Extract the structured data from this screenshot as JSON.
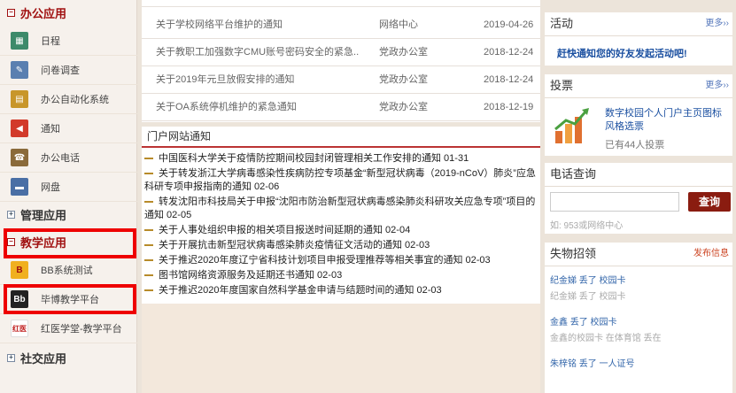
{
  "sidebar": {
    "office_title": "办公应用",
    "office_items": [
      {
        "label": "日程",
        "icon": "calendar-icon"
      },
      {
        "label": "问卷调查",
        "icon": "survey-icon"
      },
      {
        "label": "办公自动化系统",
        "icon": "office-system-icon"
      },
      {
        "label": "通知",
        "icon": "notice-icon"
      },
      {
        "label": "办公电话",
        "icon": "phone-icon"
      },
      {
        "label": "网盘",
        "icon": "netdisk-icon"
      }
    ],
    "manage_title": "管理应用",
    "teach_title": "教学应用",
    "teach_items": [
      {
        "label": "BB系统测试",
        "icon": "bb-icon"
      },
      {
        "label": "毕博教学平台",
        "icon": "bb-platform-icon"
      },
      {
        "label": "红医学堂-教学平台",
        "icon": "hongyi-icon"
      }
    ],
    "social_title": "社交应用"
  },
  "notices": [
    {
      "title": "关于学校网络平台维护的通知",
      "dept": "网络中心",
      "date": "2019-04-26"
    },
    {
      "title": "关于教职工加强数字CMU账号密码安全的紧急...",
      "dept": "党政办公室",
      "date": "2018-12-24"
    },
    {
      "title": "关于2019年元旦放假安排的通知",
      "dept": "党政办公室",
      "date": "2018-12-24"
    },
    {
      "title": "关于OA系统停机维护的紧急通知",
      "dept": "党政办公室",
      "date": "2018-12-19"
    }
  ],
  "portal": {
    "title": "门户网站通知",
    "items": [
      "中国医科大学关于疫情防控期间校园封闭管理相关工作安排的通知 01-31",
      "关于转发浙江大学病毒感染性疾病防控专项基金“新型冠状病毒（2019-nCoV）肺炎”应急科研专项申报指南的通知 02-06",
      "转发沈阳市科技局关于申报“沈阳市防治新型冠状病毒感染肺炎科研攻关应急专项”项目的通知 02-05",
      "关于人事处组织申报的相关项目报送时间延期的通知 02-04",
      "关于开展抗击新型冠状病毒感染肺炎疫情征文活动的通知 02-03",
      "关于推迟2020年度辽宁省科技计划项目申报受理推荐等相关事宜的通知 02-03",
      "图书馆网络资源服务及延期还书通知 02-03",
      "关于推迟2020年度国家自然科学基金申请与结题时间的通知 02-03"
    ]
  },
  "activity": {
    "title": "活动",
    "more": "更多››",
    "link": "赶快通知您的好友发起活动吧!"
  },
  "vote": {
    "title": "投票",
    "more": "更多››",
    "desc": "数字校园个人门户主页图标风格选票",
    "count": "已有44人投票"
  },
  "phone": {
    "title": "电话查询",
    "button": "查询",
    "placeholder": "",
    "hint": "如: 953或网络中心"
  },
  "lost": {
    "title": "失物招领",
    "more": "发布信息",
    "entries": [
      "纪金娣  丢了 校园卡",
      "纪金娣 丢了 校园卡",
      "金鑫 丢了 校园卡",
      "金鑫的校园卡 在体育馆 丢在 ",
      "朱梓铭 丢了 一人证号"
    ]
  }
}
